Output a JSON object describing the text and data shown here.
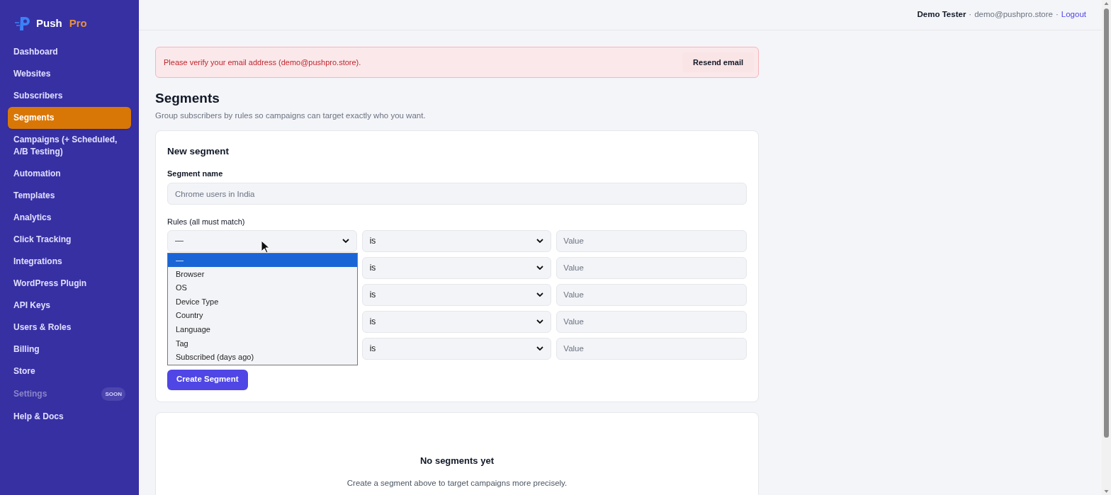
{
  "brand": {
    "name": "Push",
    "suffix": "Pro"
  },
  "sidebar": {
    "items": [
      {
        "label": "Dashboard",
        "selected": false,
        "disabled": false
      },
      {
        "label": "Websites",
        "selected": false,
        "disabled": false
      },
      {
        "label": "Subscribers",
        "selected": false,
        "disabled": false
      },
      {
        "label": "Segments",
        "selected": true,
        "disabled": false
      },
      {
        "label": "Campaigns (+ Scheduled, A/B Testing)",
        "selected": false,
        "disabled": false
      },
      {
        "label": "Automation",
        "selected": false,
        "disabled": false
      },
      {
        "label": "Templates",
        "selected": false,
        "disabled": false
      },
      {
        "label": "Analytics",
        "selected": false,
        "disabled": false
      },
      {
        "label": "Click Tracking",
        "selected": false,
        "disabled": false
      },
      {
        "label": "Integrations",
        "selected": false,
        "disabled": false
      },
      {
        "label": "WordPress Plugin",
        "selected": false,
        "disabled": false
      },
      {
        "label": "API Keys",
        "selected": false,
        "disabled": false
      },
      {
        "label": "Users & Roles",
        "selected": false,
        "disabled": false
      },
      {
        "label": "Billing",
        "selected": false,
        "disabled": false
      },
      {
        "label": "Store",
        "selected": false,
        "disabled": false
      },
      {
        "label": "Settings",
        "selected": false,
        "disabled": true,
        "badge": "SOON"
      },
      {
        "label": "Help & Docs",
        "selected": false,
        "disabled": false
      }
    ]
  },
  "header": {
    "user": "Demo Tester",
    "separator_1": "·",
    "email": "demo@pushpro.store",
    "separator_2": "·",
    "logout": "Logout"
  },
  "banner": {
    "message": "Please verify your email address (demo@pushpro.store).",
    "action": "Resend email"
  },
  "page": {
    "title": "Segments",
    "subtitle": "Group subscribers by rules so campaigns can target exactly who you want."
  },
  "form": {
    "title": "New segment",
    "name_label": "Segment name",
    "name_placeholder": "Chrome users in India",
    "rules_label": "Rules (all must match)",
    "rules": [
      {
        "field": "—",
        "operator": "is",
        "value_placeholder": "Value"
      },
      {
        "operator": "is",
        "value_placeholder": "Value"
      },
      {
        "operator": "is",
        "value_placeholder": "Value"
      },
      {
        "operator": "is",
        "value_placeholder": "Value"
      },
      {
        "operator": "is",
        "value_placeholder": "Value"
      }
    ],
    "dropdown": {
      "options": [
        {
          "label": "—",
          "selected": true
        },
        {
          "label": "Browser",
          "selected": false
        },
        {
          "label": "OS",
          "selected": false
        },
        {
          "label": "Device Type",
          "selected": false
        },
        {
          "label": "Country",
          "selected": false
        },
        {
          "label": "Language",
          "selected": false
        },
        {
          "label": "Tag",
          "selected": false
        },
        {
          "label": "Subscribed (days ago)",
          "selected": false
        }
      ]
    },
    "submit": "Create Segment"
  },
  "empty": {
    "title": "No segments yet",
    "text": "Create a segment above to target campaigns more precisely."
  }
}
